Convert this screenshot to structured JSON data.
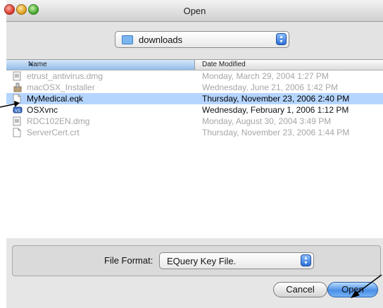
{
  "window": {
    "title": "Open"
  },
  "location": {
    "folder": "downloads"
  },
  "columns": {
    "name": "Name",
    "date": "Date Modified"
  },
  "files": [
    {
      "name": "etrust_antivirus.dmg",
      "date": "Monday, March 29, 2004 1:27 PM",
      "icon": "disk-image-icon",
      "state": "disabled"
    },
    {
      "name": "macOSX_Installer",
      "date": "Wednesday, June 21, 2006 1:42 PM",
      "icon": "installer-icon",
      "state": "disabled"
    },
    {
      "name": "MyMedical.eqk",
      "date": "Thursday, November 23, 2006 2:40 PM",
      "icon": "document-icon",
      "state": "selected"
    },
    {
      "name": "OSXvnc",
      "date": "Wednesday, February 1, 2006 1:12 PM",
      "icon": "application-icon",
      "state": "enabled"
    },
    {
      "name": "RDC102EN.dmg",
      "date": "Monday, August 30, 2004 3:49 PM",
      "icon": "disk-image-icon",
      "state": "disabled"
    },
    {
      "name": "ServerCert.crt",
      "date": "Thursday, November 23, 2006 1:44 PM",
      "icon": "document-icon",
      "state": "disabled"
    }
  ],
  "footer": {
    "format_label": "File Format:",
    "format_value": "EQuery Key File.",
    "cancel": "Cancel",
    "open": "Open"
  },
  "colors": {
    "selection": "#b5d5ff",
    "accent": "#4b8fe5"
  }
}
